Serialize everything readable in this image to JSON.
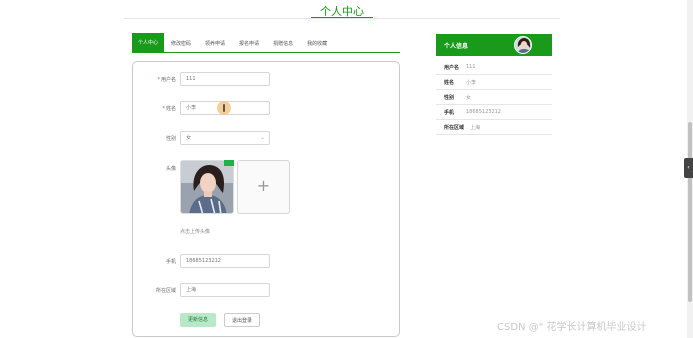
{
  "header": {
    "title": "个人中心"
  },
  "tabs": [
    {
      "label": "个人中心",
      "active": true
    },
    {
      "label": "修改密码"
    },
    {
      "label": "领养申请"
    },
    {
      "label": "报名申请"
    },
    {
      "label": "捐赠信息"
    },
    {
      "label": "我的收藏"
    }
  ],
  "form": {
    "username_label": "用户名",
    "username_value": "111",
    "name_label": "姓名",
    "name_value": "小李",
    "gender_label": "性别",
    "gender_value": "女",
    "avatar_label": "头像",
    "upload_icon": "+",
    "avatar_hint": "点击上传头像",
    "phone_label": "手机",
    "phone_value": "18685123212",
    "region_label": "所在区域",
    "region_value": "上海",
    "save_label": "更新信息",
    "logout_label": "退出登录",
    "required_mark": "*"
  },
  "profile": {
    "title": "个人信息",
    "rows": [
      {
        "key": "用户名",
        "value": "111"
      },
      {
        "key": "姓名",
        "value": "小李"
      },
      {
        "key": "性别",
        "value": "女"
      },
      {
        "key": "手机",
        "value": "18685123212"
      },
      {
        "key": "所在区域",
        "value": "上海"
      }
    ]
  },
  "side_toggle_icon": "‹",
  "watermark": "CSDN @\" 花学长计算机毕业设计",
  "colors": {
    "accent": "#1a9a1a",
    "save_button": "#b9e8c9"
  }
}
